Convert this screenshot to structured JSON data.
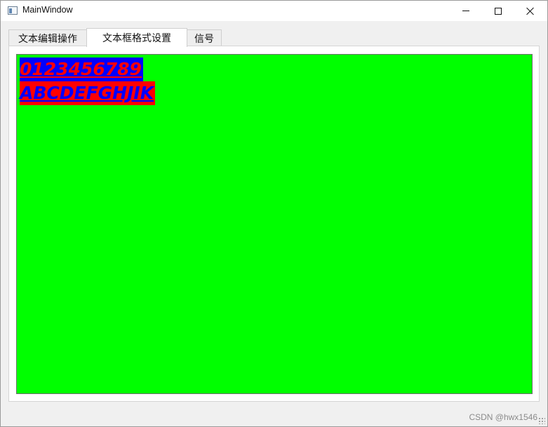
{
  "window": {
    "title": "MainWindow"
  },
  "tabs": [
    {
      "label": "文本编辑操作",
      "selected": false
    },
    {
      "label": "文本框格式设置",
      "selected": true
    },
    {
      "label": "信号",
      "selected": false
    }
  ],
  "editor": {
    "background_color": "#00ff00",
    "lines": [
      {
        "text": "0123456789",
        "text_color": "#ff0000",
        "highlight_color": "#0000ff",
        "bold": true,
        "italic": true,
        "underline": true
      },
      {
        "text": "ABCDEFGHJIK",
        "text_color": "#0000ff",
        "highlight_color": "#ff0000",
        "bold": true,
        "italic": true,
        "underline": true
      }
    ]
  },
  "watermark": "CSDN @hwx1546"
}
